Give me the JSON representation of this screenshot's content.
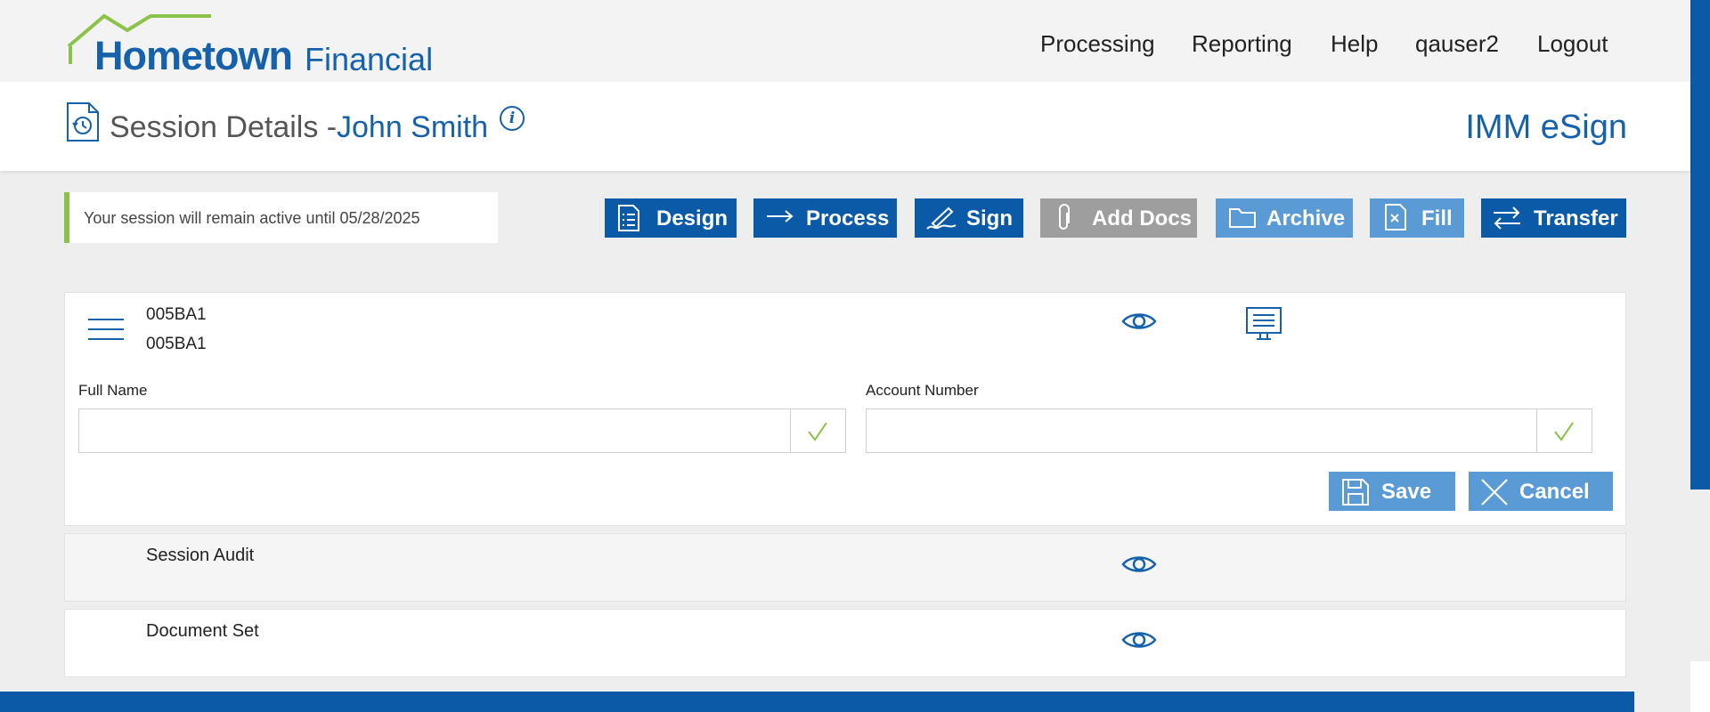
{
  "logo": {
    "brand": "Hometown",
    "suffix": "Financial"
  },
  "nav": [
    "Processing",
    "Reporting",
    "Help",
    "qauser2",
    "Logout"
  ],
  "header": {
    "title": "Session Details -",
    "name": "John Smith",
    "info_icon": "i",
    "product": "IMM eSign"
  },
  "notice": {
    "text": "Your session will remain active until 05/28/2025"
  },
  "toolbar": {
    "design": "Design",
    "process": "Process",
    "sign": "Sign",
    "add_docs": "Add Docs",
    "archive": "Archive",
    "fill": "Fill",
    "transfer": "Transfer"
  },
  "panel": {
    "code1": "005BA1",
    "code2": "005BA1",
    "full_name_label": "Full Name",
    "full_name_value": "",
    "account_number_label": "Account Number",
    "account_number_value": "",
    "save": "Save",
    "cancel": "Cancel"
  },
  "sections": {
    "audit": "Session Audit",
    "document_set": "Document Set"
  },
  "colors": {
    "primary": "#0a5aa8",
    "light_button": "#5b9bd5",
    "disabled": "#9e9e9e",
    "accent_green": "#8bc34a"
  },
  "icons": [
    "house-roof-icon",
    "session-history-icon",
    "info-icon",
    "design-list-icon",
    "arrow-right-icon",
    "signature-pen-icon",
    "paperclip-icon",
    "folder-icon",
    "fill-form-icon",
    "transfer-arrows-icon",
    "hamburger-menu-icon",
    "eye-icon",
    "monitor-icon",
    "checkmark-icon",
    "save-disk-icon",
    "close-x-icon"
  ]
}
